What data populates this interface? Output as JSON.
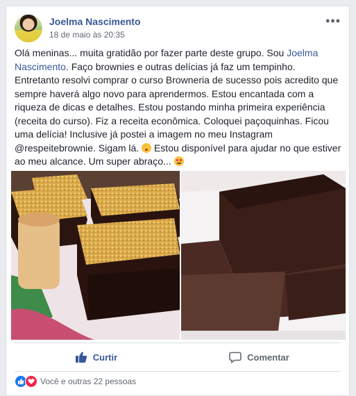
{
  "post": {
    "author": "Joelma Nascimento",
    "timestamp": "18 de maio às 20:35",
    "more_icon": "more-horizontal-icon",
    "text_before_link": "Olá meninas... muita gratidão por fazer parte deste grupo. Sou ",
    "link_text": "Joelma Nascimento",
    "text_after_link": ". Faço brownies e outras delícias já faz um tempinho. Entretanto resolvi comprar o curso Browneria de sucesso pois acredito que sempre haverá algo novo para aprendermos. Estou encantada com a riqueza de dicas e detalhes. Estou postando minha primeira experiência (receita do curso). Fiz a receita econômica. Coloquei paçoquinhas. Ficou uma delícia! Inclusive já postei a imagem no meu Instagram @respeitebrownie. Sigam lá. ",
    "text_after_emoji_1": " Estou disponível para ajudar no que estiver ao meu alcance. Um super abraço... ",
    "emoji_1": "kissing-face-icon",
    "emoji_2": "heart-eyes-face-icon"
  },
  "actions": {
    "like_label": "Curtir",
    "comment_label": "Comentar"
  },
  "reactions": {
    "summary": "Você e outras 22 pessoas",
    "colors": {
      "like": "#1877f2",
      "love": "#f0284a"
    }
  },
  "theme": {
    "link_color": "#385898",
    "text_color": "#1d2129",
    "muted_color": "#616770",
    "background": "#e9ebee"
  }
}
